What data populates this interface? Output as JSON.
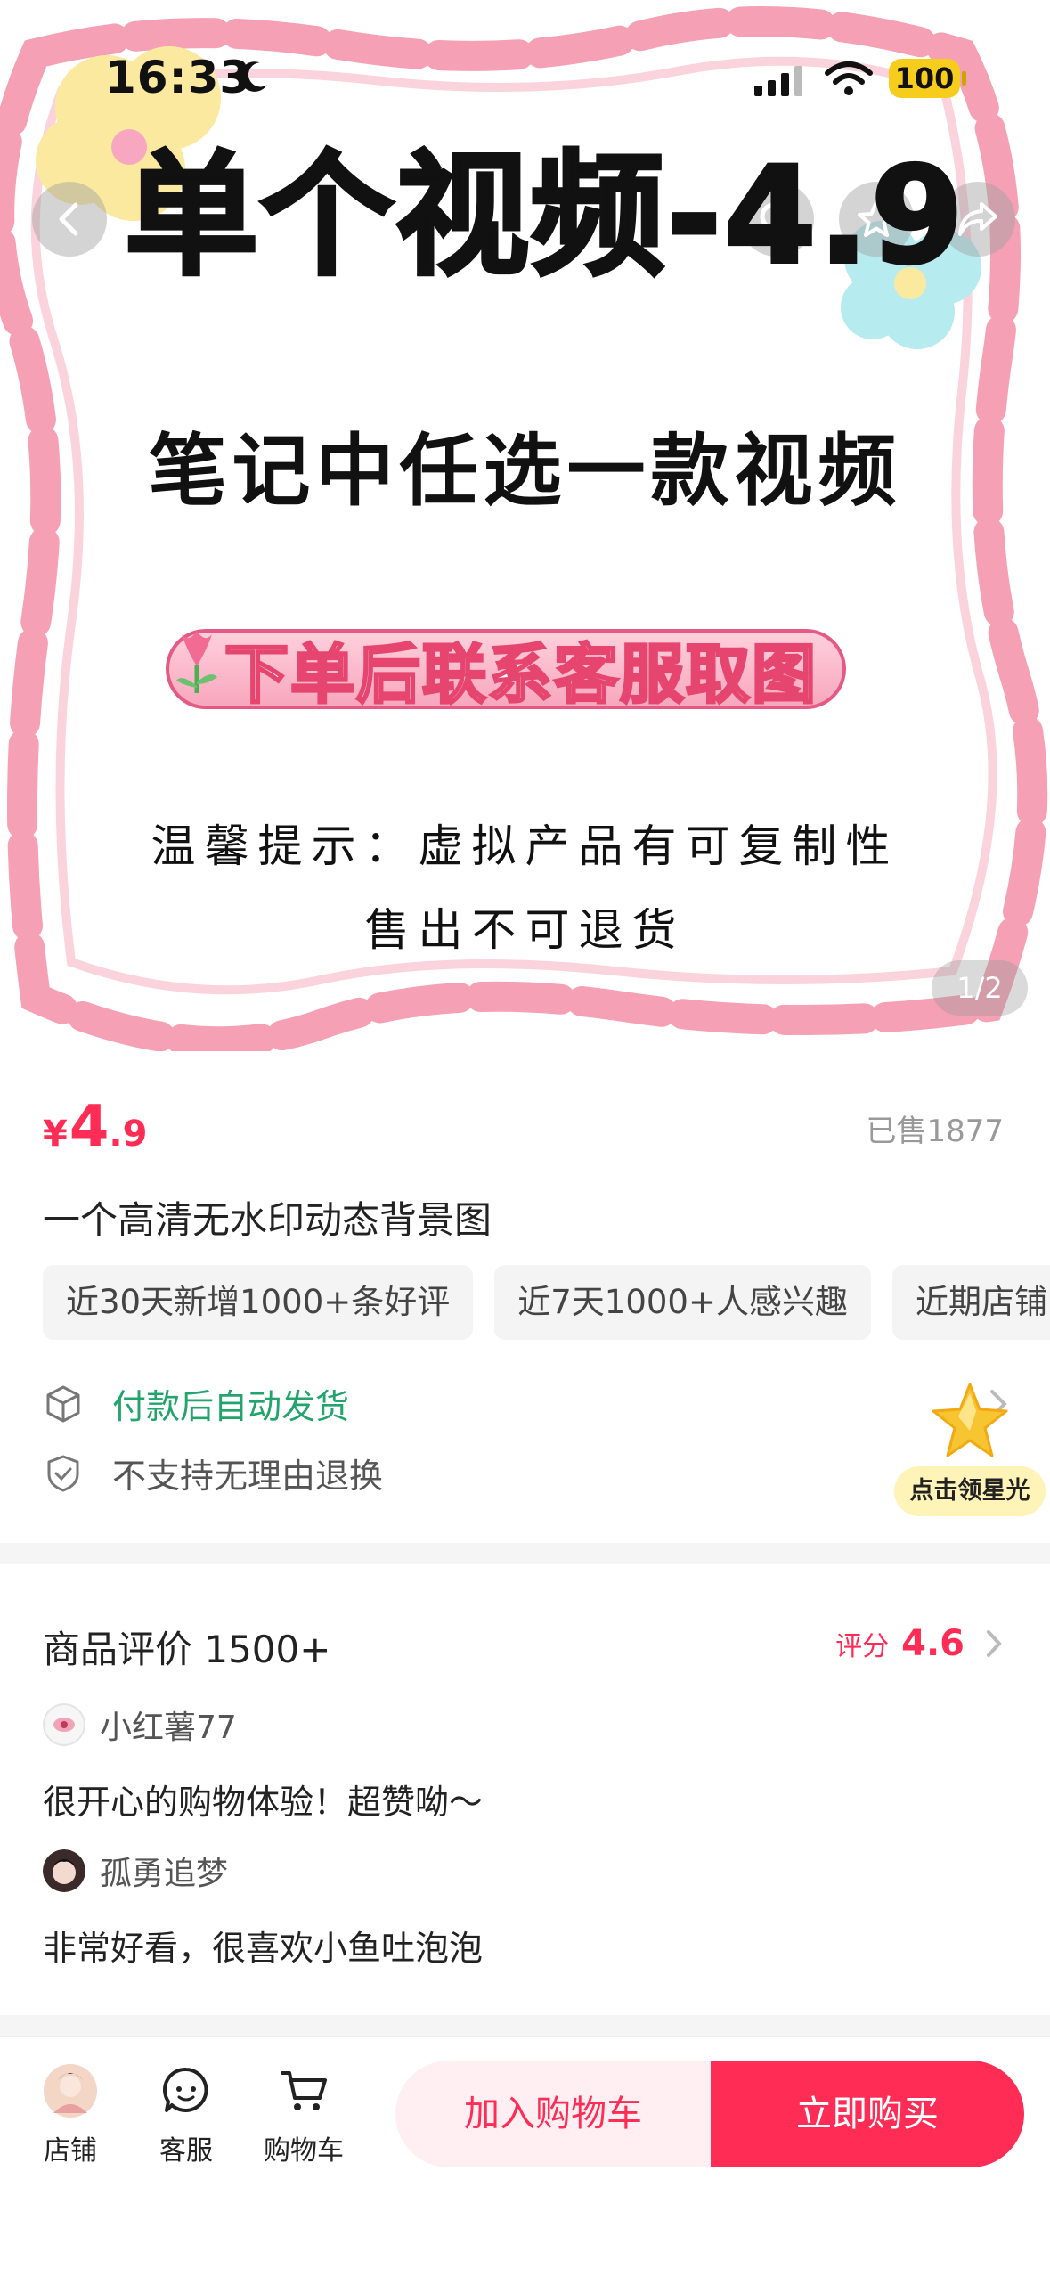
{
  "status_bar": {
    "time": "16:33",
    "battery": "100"
  },
  "hero": {
    "title": "单个视频-4.9",
    "subtitle": "笔记中任选一款视频",
    "banner": "下单后联系客服取图",
    "tip_line1": "温馨提示：虚拟产品有可复制性",
    "tip_line2": "售出不可退货",
    "page_indicator": "1/2"
  },
  "product": {
    "currency": "¥",
    "price_int": "4",
    "price_dec": ".9",
    "sold": "已售1877",
    "title": "一个高清无水印动态背景图",
    "tags": [
      "近30天新增1000+条好评",
      "近7天1000+人感兴趣",
      "近期店铺"
    ],
    "services": [
      "付款后自动发货",
      "不支持无理由退换"
    ],
    "star_badge": "点击领星光"
  },
  "reviews": {
    "title": "商品评价 1500+",
    "score_label": "评分",
    "score": "4.6",
    "items": [
      {
        "name": "小红薯77",
        "text": "很开心的购物体验！超赞呦～"
      },
      {
        "name": "孤勇追梦",
        "text": "非常好看，很喜欢小鱼吐泡泡"
      }
    ]
  },
  "bottom_bar": {
    "store": "店铺",
    "service": "客服",
    "cart": "购物车",
    "add_to_cart": "加入购物车",
    "buy_now": "立即购买"
  },
  "colors": {
    "accent": "#ff2d55",
    "green": "#23a46c",
    "frame_pink": "#f5a0b4"
  }
}
